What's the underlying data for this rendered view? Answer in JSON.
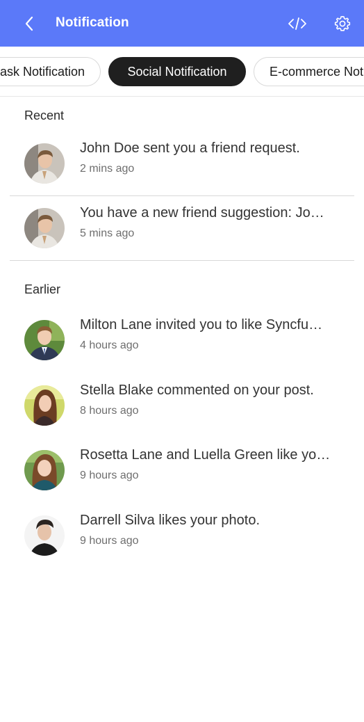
{
  "header": {
    "title": "Notification",
    "back_icon": "chevron-left-icon",
    "code_icon": "code-icon",
    "settings_icon": "gear-icon",
    "background": "#5b79f9"
  },
  "tabs": [
    {
      "label": "Task Notification",
      "visible_label": "ask Notification",
      "active": false
    },
    {
      "label": "Social Notification",
      "active": true
    },
    {
      "label": "E-commerce Notification",
      "visible_label": "E-commerce Not",
      "active": false
    }
  ],
  "sections": {
    "recent": "Recent",
    "earlier": "Earlier"
  },
  "recent": [
    {
      "message": "John Doe sent you a friend request.",
      "time": "2 mins ago"
    },
    {
      "message": "You have a new friend suggestion: Jo…",
      "time": "5 mins ago"
    }
  ],
  "earlier": [
    {
      "message": "Milton Lane invited you to like Syncfu…",
      "time": "4 hours ago"
    },
    {
      "message": "Stella Blake commented on your post.",
      "time": "8 hours ago"
    },
    {
      "message": "Rosetta Lane and Luella Green like yo…",
      "time": "9 hours ago"
    },
    {
      "message": "Darrell Silva likes your photo.",
      "time": "9 hours ago"
    }
  ]
}
